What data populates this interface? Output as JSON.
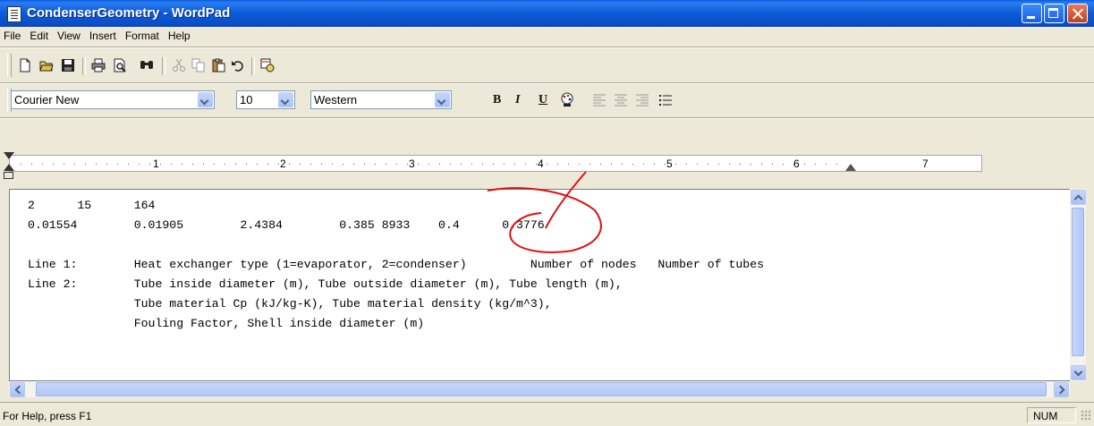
{
  "window": {
    "title": "CondenserGeometry - WordPad"
  },
  "menu": {
    "items": [
      "File",
      "Edit",
      "View",
      "Insert",
      "Format",
      "Help"
    ]
  },
  "toolbar": {
    "icons": [
      "new-icon",
      "open-icon",
      "save-icon",
      "print-icon",
      "print-preview-icon",
      "find-icon",
      "cut-icon",
      "copy-icon",
      "paste-icon",
      "undo-icon",
      "datetime-icon"
    ]
  },
  "format_bar": {
    "font": "Courier New",
    "size": "10",
    "script": "Western",
    "bold": "B",
    "italic": "I",
    "underline": "U"
  },
  "ruler": {
    "marks": [
      "1",
      "2",
      "3",
      "4",
      "5",
      "6",
      "7"
    ]
  },
  "document": {
    "lines": [
      "2      15      164",
      "0.01554        0.01905        2.4384        0.385 8933    0.4      0.3776",
      "",
      "Line 1:        Heat exchanger type (1=evaporator, 2=condenser)         Number of nodes   Number of tubes",
      "Line 2:        Tube inside diameter (m), Tube outside diameter (m), Tube length (m),",
      "               Tube material Cp (kJ/kg-K), Tube material density (kg/m^3),",
      "               Fouling Factor, Shell inside diameter (m)"
    ]
  },
  "statusbar": {
    "help": "For Help, press F1",
    "num": "NUM"
  },
  "colors": {
    "titlebar": "#0a5ce0",
    "annotation": "#e01010"
  }
}
